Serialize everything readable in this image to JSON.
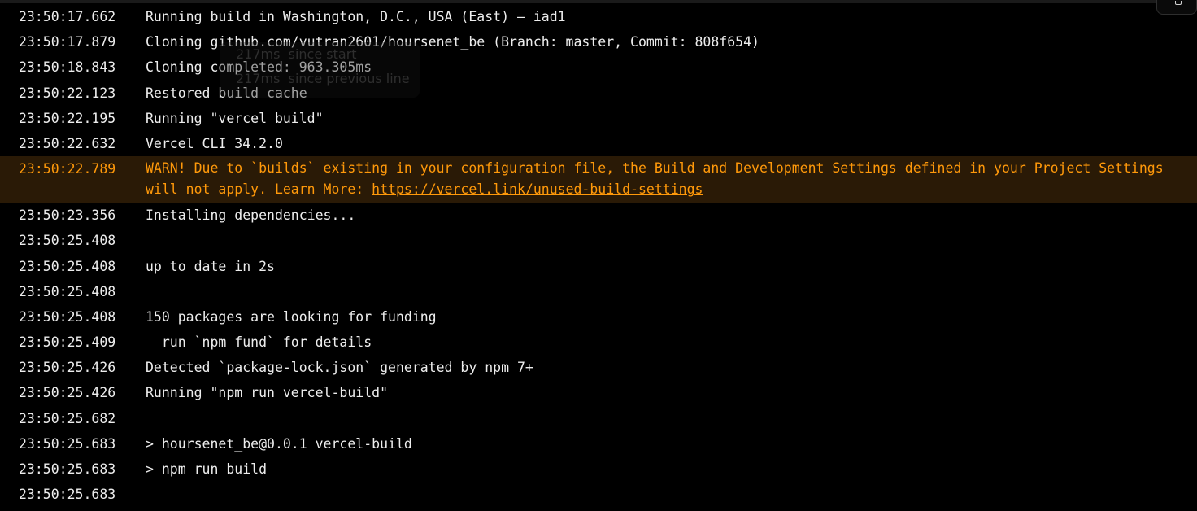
{
  "log": {
    "lines": [
      {
        "time": "23:50:17.662",
        "text": "Running build in Washington, D.C., USA (East) – iad1"
      },
      {
        "time": "23:50:17.879",
        "text": "Cloning github.com/vutran2601/hoursenet_be (Branch: master, Commit: 808f654)"
      },
      {
        "time": "23:50:18.843",
        "text": "Cloning completed: 963.305ms"
      },
      {
        "time": "23:50:22.123",
        "text": "Restored build cache"
      },
      {
        "time": "23:50:22.195",
        "text": "Running \"vercel build\""
      },
      {
        "time": "23:50:22.632",
        "text": "Vercel CLI 34.2.0"
      },
      {
        "time": "23:50:22.789",
        "text": "WARN! Due to `builds` existing in your configuration file, the Build and Development Settings defined in your Project Settings will not apply. Learn More: ",
        "link": "https://vercel.link/unused-build-settings"
      },
      {
        "time": "23:50:23.356",
        "text": "Installing dependencies..."
      },
      {
        "time": "23:50:25.408",
        "text": ""
      },
      {
        "time": "23:50:25.408",
        "text": "up to date in 2s"
      },
      {
        "time": "23:50:25.408",
        "text": ""
      },
      {
        "time": "23:50:25.408",
        "text": "150 packages are looking for funding"
      },
      {
        "time": "23:50:25.409",
        "text": "  run `npm fund` for details"
      },
      {
        "time": "23:50:25.426",
        "text": "Detected `package-lock.json` generated by npm 7+"
      },
      {
        "time": "23:50:25.426",
        "text": "Running \"npm run vercel-build\""
      },
      {
        "time": "23:50:25.682",
        "text": ""
      },
      {
        "time": "23:50:25.683",
        "text": "> hoursenet_be@0.0.1 vercel-build"
      },
      {
        "time": "23:50:25.683",
        "text": "> npm run build"
      },
      {
        "time": "23:50:25.683",
        "text": ""
      }
    ]
  },
  "tooltip": {
    "since_start": "217ms  since start",
    "since_previous": "217ms  since previous line"
  },
  "colors": {
    "background": "#000000",
    "text": "#ededed",
    "warning": "#ff990a",
    "warning_background": "#2a1a06"
  },
  "icons": {
    "corner_button": "copy-icon"
  }
}
